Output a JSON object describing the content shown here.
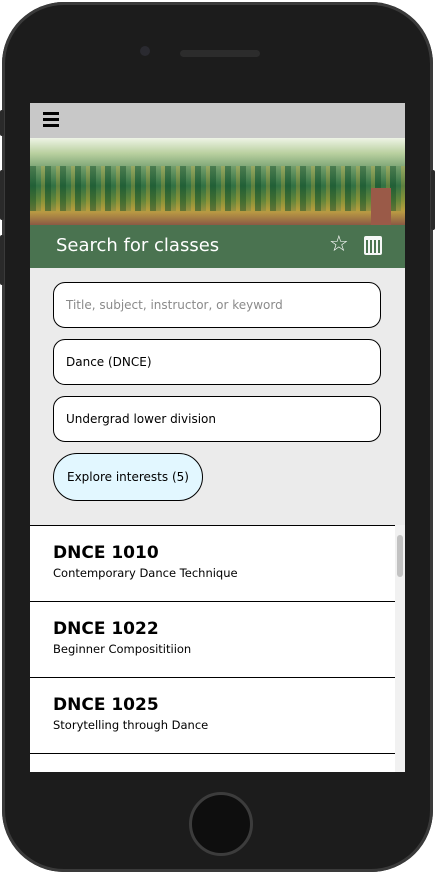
{
  "header": {
    "title": "Search for classes"
  },
  "icons": {
    "menu": "hamburger-icon",
    "favorites": "star-icon",
    "schedule": "calendar-icon"
  },
  "filters": {
    "search_placeholder": "Title, subject, instructor, or keyword",
    "subject": "Dance (DNCE)",
    "level": "Undergrad lower division",
    "interests_button": "Explore interests (5)"
  },
  "courses": [
    {
      "code": "DNCE 1010",
      "title": "Contemporary Dance Technique"
    },
    {
      "code": "DNCE 1022",
      "title": "Beginner Composititiion"
    },
    {
      "code": "DNCE 1025",
      "title": "Storytelling through Dance"
    }
  ],
  "colors": {
    "header_green": "#4a7350",
    "chip_bg": "#e2f7ff"
  }
}
